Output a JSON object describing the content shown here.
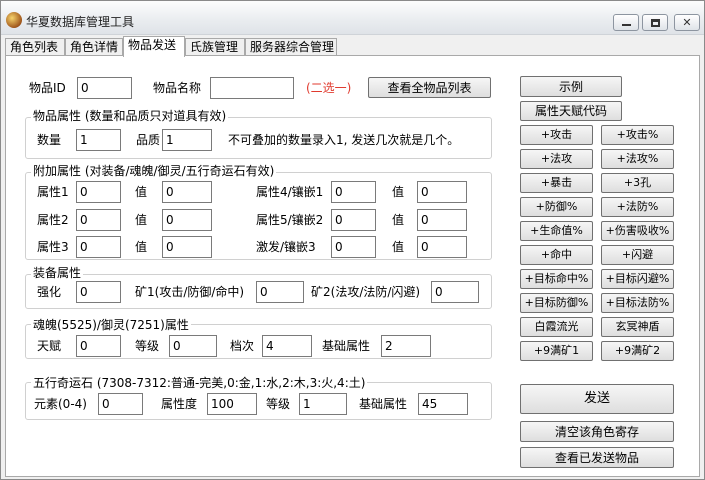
{
  "window": {
    "title": "华夏数据库管理工具",
    "close_glyph": "✕"
  },
  "tabs": [
    "角色列表",
    "角色详情",
    "物品发送",
    "氏族管理",
    "服务器综合管理"
  ],
  "item": {
    "id_label": "物品ID",
    "id_value": "0",
    "name_label": "物品名称",
    "name_value": "",
    "choose_hint": "(二选一)",
    "view_all_button": "查看全物品列表"
  },
  "props": {
    "title": "物品属性 (数量和品质只对道具有效)",
    "qty_label": "数量",
    "qty_value": "1",
    "quality_label": "品质",
    "quality_value": "1",
    "note": "不可叠加的数量录入1, 发送几次就是几个。"
  },
  "extra": {
    "title": "附加属性 (对装备/魂魄/御灵/五行奇运石有效)",
    "value_label": "值",
    "rows": [
      {
        "l1": "属性1",
        "v1": "0",
        "val1": "0",
        "l2": "属性4/镶嵌1",
        "v2": "0",
        "val2": "0"
      },
      {
        "l1": "属性2",
        "v1": "0",
        "val1": "0",
        "l2": "属性5/镶嵌2",
        "v2": "0",
        "val2": "0"
      },
      {
        "l1": "属性3",
        "v1": "0",
        "val1": "0",
        "l2": "激发/镶嵌3",
        "v2": "0",
        "val2": "0"
      }
    ]
  },
  "equip": {
    "title": "装备属性",
    "strength_label": "强化",
    "strength_value": "0",
    "ore1_label": "矿1(攻击/防御/命中)",
    "ore1_value": "0",
    "ore2_label": "矿2(法攻/法防/闪避)",
    "ore2_value": "0"
  },
  "soul": {
    "title": "魂魄(5525)/御灵(7251)属性",
    "talent_label": "天赋",
    "talent_value": "0",
    "level_label": "等级",
    "level_value": "0",
    "grade_label": "档次",
    "grade_value": "4",
    "base_label": "基础属性",
    "base_value": "2"
  },
  "stone": {
    "title": "五行奇运石 (7308-7312:普通-完美,0:金,1:水,2:木,3:火,4:土)",
    "element_label": "元素(0-4)",
    "element_value": "0",
    "degree_label": "属性度",
    "degree_value": "100",
    "level_label": "等级",
    "level_value": "1",
    "base_label": "基础属性",
    "base_value": "45"
  },
  "right": {
    "example": "示例",
    "talent_code": "属性天赋代码",
    "buttons": [
      "+攻击",
      "+攻击%",
      "+法攻",
      "+法攻%",
      "+暴击",
      "+3孔",
      "+防御%",
      "+法防%",
      "+生命值%",
      "+伤害吸收%",
      "+命中",
      "+闪避",
      "+目标命中%",
      "+目标闪避%",
      "+目标防御%",
      "+目标法防%",
      "白霞流光",
      "玄冥神盾",
      "+9满矿1",
      "+9满矿2"
    ],
    "send": "发送",
    "clear": "清空该角色寄存",
    "view_sent": "查看已发送物品"
  }
}
